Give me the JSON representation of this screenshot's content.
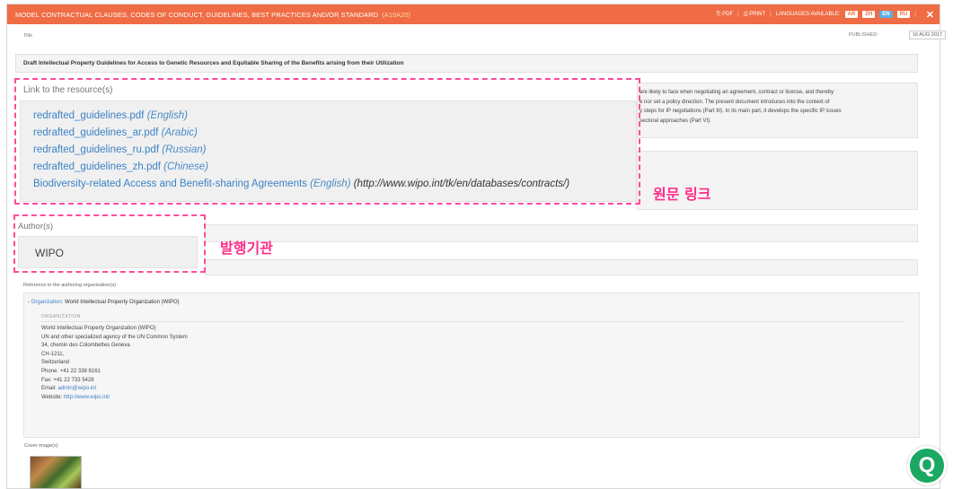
{
  "titlebar": {
    "title": "MODEL CONTRACTUAL CLAUSES, CODES OF CONDUCT, GUIDELINES, BEST PRACTICES AND/OR STANDARD",
    "code": "(A19A20)",
    "pdf": "PDF",
    "print": "PRINT",
    "languages_label": "LANGUAGES AVAILABLE:",
    "languages": [
      "AR",
      "ZH",
      "EN",
      "RU"
    ],
    "active_language": "EN",
    "close": "✕"
  },
  "published": {
    "label": "PUBLISHED:",
    "date": "16 AUG 2017"
  },
  "title_section": {
    "label": "Title",
    "value": "Draft Intellectual Property Guidelines for Access to Genetic Resources and Equitable Sharing of the Benefits arising from their Utilization"
  },
  "abstract": {
    "lines": [
      "are likely to face when negotiating an agreement, contract or license, and thereby",
      "e nor set a policy direction. The present document introduces into the context of",
      "y steps for IP negotiations (Part III). In its main part, it develops the specific IP issues",
      "sectoral approaches (Part VI)."
    ]
  },
  "resources": {
    "label": "Link to the resource(s)",
    "links": [
      {
        "file": "redrafted_guidelines.pdf",
        "lang": "(English)",
        "url": ""
      },
      {
        "file": "redrafted_guidelines_ar.pdf",
        "lang": "(Arabic)",
        "url": ""
      },
      {
        "file": "redrafted_guidelines_ru.pdf",
        "lang": "(Russian)",
        "url": ""
      },
      {
        "file": "redrafted_guidelines_zh.pdf",
        "lang": "(Chinese)",
        "url": ""
      },
      {
        "file": "Biodiversity-related Access and Benefit-sharing Agreements",
        "lang": "(English)",
        "url": "(http://www.wipo.int/tk/en/databases/contracts/)"
      }
    ]
  },
  "annotations": {
    "resource_link": "원문 링크",
    "issuer": "발행기관"
  },
  "authors": {
    "label": "Author(s)",
    "value": "WIPO"
  },
  "reference": {
    "label": "Reference to the authoring organisation(s)",
    "toggle": "-",
    "org_key": "Organization:",
    "org_name": "World Intellectual Property Organization (WIPO)",
    "section_title": "ORGANIZATION",
    "lines": [
      "World Intellectual Property Organization (WIPO)",
      "UN and other specialized agency of the UN Common System",
      "34, chemin des Colombettes Geneva",
      "CH-1211,",
      "Switzerland",
      "Phone: +41 22 338 8161",
      "Fax: +41 22 733 5428"
    ],
    "email_label": "Email:",
    "email": "admin@wipo.int",
    "website_label": "Website:",
    "website": "http://www.wipo.int/"
  },
  "cover": {
    "label": "Cover image(s)"
  },
  "help": {
    "icon": "help-chat-icon",
    "glyph": "Q"
  },
  "colors": {
    "titlebar": "#ef6c44",
    "link": "#3c82c4",
    "annotation": "#ff2d8a",
    "help": "#1aa862"
  }
}
